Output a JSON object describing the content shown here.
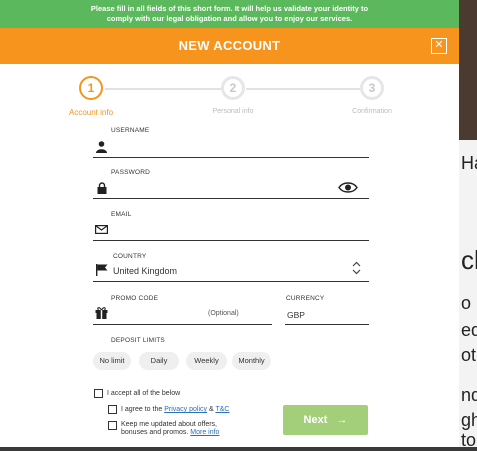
{
  "notice": {
    "line1": "Please fill in all fields of this short form. It will help us validate your identity to",
    "line2": "comply with our legal obligation and allow you to enjoy our services."
  },
  "header": {
    "title": "NEW ACCOUNT",
    "close_icon": "close-icon"
  },
  "steps": [
    {
      "number": "1",
      "label": "Account info",
      "active": true
    },
    {
      "number": "2",
      "label": "Personal info",
      "active": false
    },
    {
      "number": "3",
      "label": "Confirmation",
      "active": false
    }
  ],
  "form": {
    "username": {
      "label": "USERNAME",
      "value": ""
    },
    "password": {
      "label": "PASSWORD",
      "value": ""
    },
    "email": {
      "label": "EMAIL",
      "value": ""
    },
    "country": {
      "label": "COUNTRY",
      "value": "United Kingdom"
    },
    "promo": {
      "label": "PROMO CODE",
      "hint": "(Optional)"
    },
    "currency": {
      "label": "CURRENCY",
      "value": "GBP"
    },
    "deposit_limits": {
      "label": "DEPOSIT LIMITS",
      "options": [
        "No limit",
        "Daily",
        "Weekly",
        "Monthly"
      ]
    }
  },
  "consent": {
    "accept_all": "I accept all of the below",
    "agree_prefix": "I agree to the ",
    "privacy_policy": "Privacy policy",
    "amp": " & ",
    "tc": "T&C",
    "keep_line1": "Keep me updated about offers,",
    "keep_line2": "bonuses and promos. ",
    "more_info": "More info"
  },
  "next_button": {
    "label": "Next",
    "arrow": "→"
  },
  "background": {
    "letters": [
      "Ha",
      "ck",
      "o",
      "ed",
      "ot",
      "nd",
      "gh",
      "to"
    ]
  },
  "colors": {
    "accent": "#f7941d",
    "notice": "#5cb85c",
    "next": "#a3cf7a",
    "link": "#2c6fb7"
  }
}
